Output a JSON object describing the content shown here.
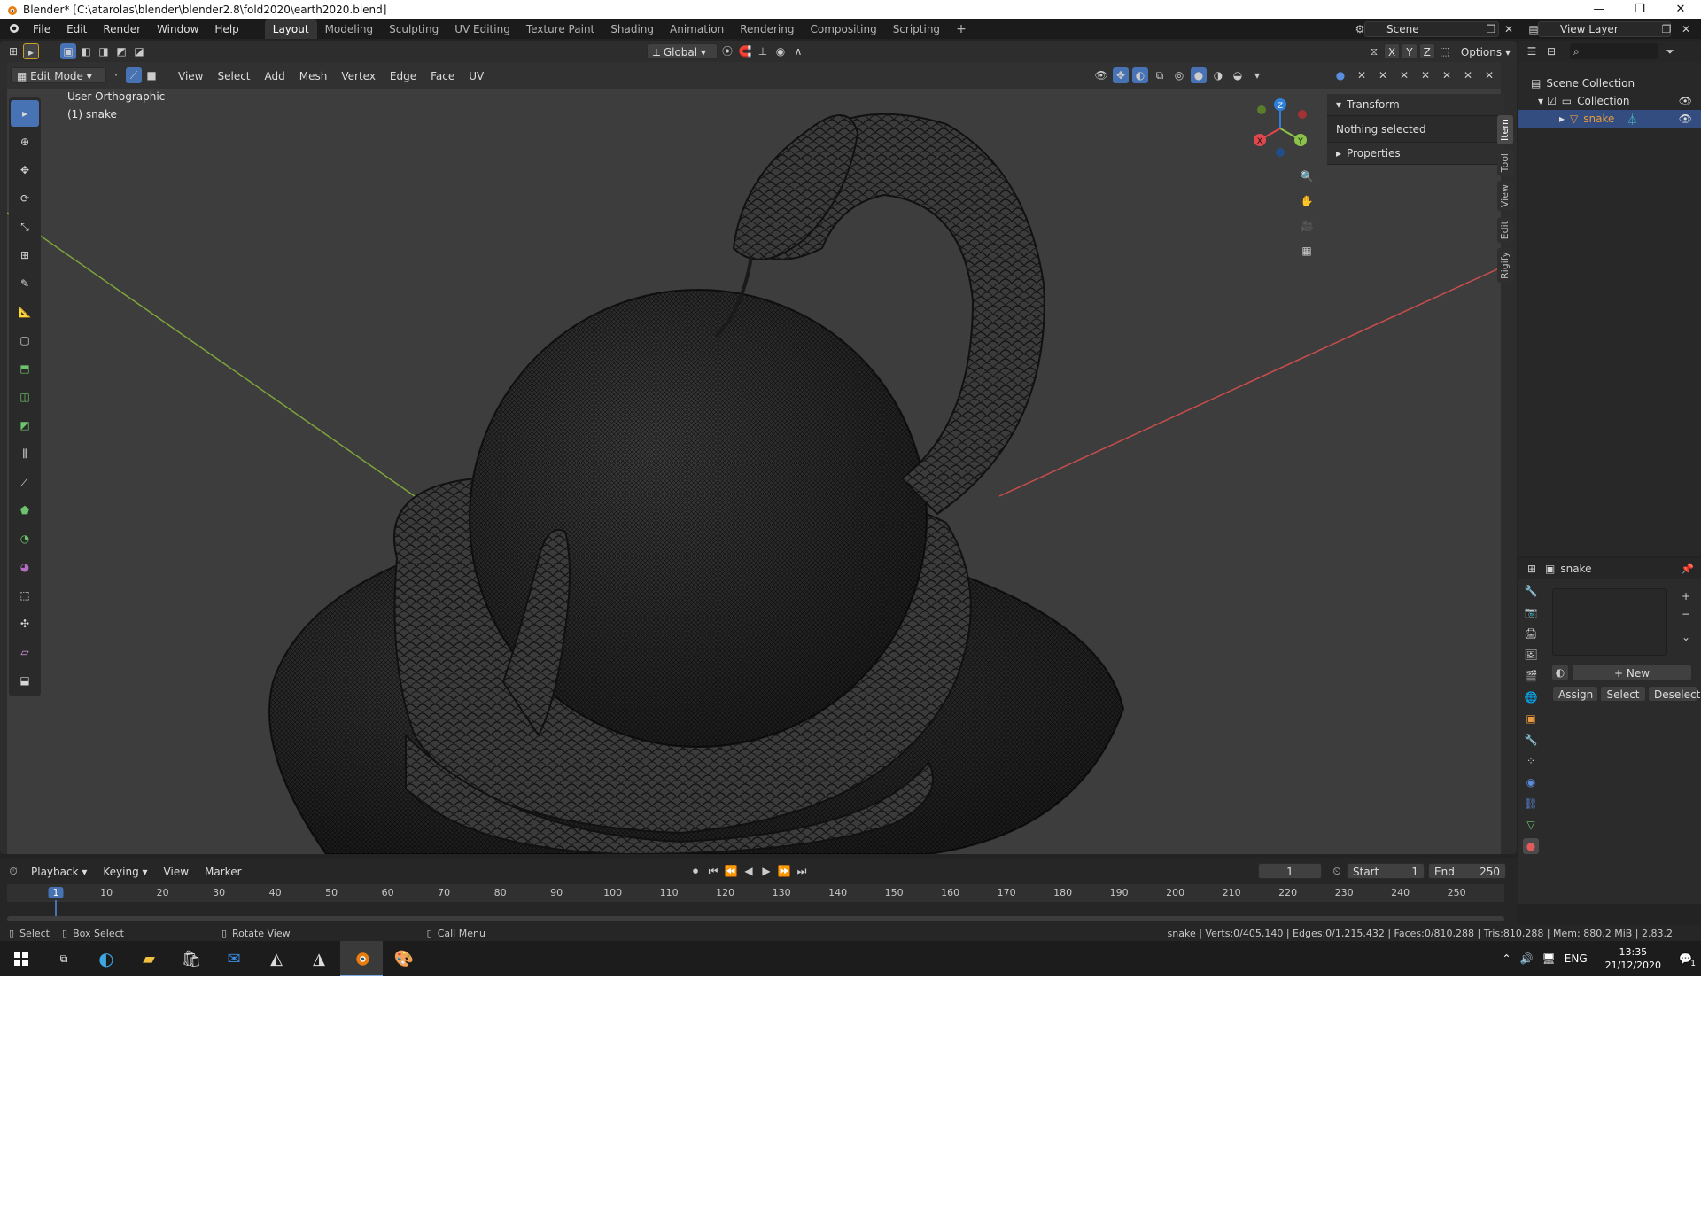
{
  "window": {
    "title": "Blender* [C:\\atarolas\\blender\\blender2.8\\fold2020\\earth2020.blend]",
    "controls": [
      "—",
      "❐",
      "✕"
    ]
  },
  "menu": {
    "items": [
      "File",
      "Edit",
      "Render",
      "Window",
      "Help"
    ]
  },
  "workspaces": {
    "tabs": [
      "Layout",
      "Modeling",
      "Sculpting",
      "UV Editing",
      "Texture Paint",
      "Shading",
      "Animation",
      "Rendering",
      "Compositing",
      "Scripting"
    ],
    "active": "Layout",
    "add": "+"
  },
  "scene": {
    "name": "Scene"
  },
  "view_layer": {
    "name": "View Layer"
  },
  "tool_header": {
    "orientation": "Global",
    "xyz": [
      "X",
      "Y",
      "Z"
    ],
    "options": "Options"
  },
  "viewport_header": {
    "mode": "Edit Mode",
    "menus": [
      "View",
      "Select",
      "Add",
      "Mesh",
      "Vertex",
      "Edge",
      "Face",
      "UV"
    ]
  },
  "viewport": {
    "view_name": "User Orthographic",
    "object_label": "(1) snake",
    "gizmo": {
      "x": "X",
      "y": "Y",
      "z": "Z"
    }
  },
  "npanel": {
    "transform_label": "Transform",
    "nothing_selected": "Nothing selected",
    "properties_label": "Properties",
    "tabs": [
      "Item",
      "Tool",
      "View",
      "Edit",
      "Rigify"
    ],
    "active_tab": "Item"
  },
  "outliner": {
    "scene_collection": "Scene Collection",
    "collection": "Collection",
    "object": "snake"
  },
  "properties": {
    "object_name": "snake",
    "new_label": "New",
    "assign": "Assign",
    "select": "Select",
    "deselect": "Deselect"
  },
  "timeline": {
    "menus": [
      "Playback",
      "Keying",
      "View",
      "Marker"
    ],
    "current_frame": "1",
    "start_label": "Start",
    "start": "1",
    "end_label": "End",
    "end": "250",
    "ruler_ticks": [
      "1",
      "10",
      "20",
      "30",
      "40",
      "50",
      "60",
      "70",
      "80",
      "90",
      "100",
      "110",
      "120",
      "130",
      "140",
      "150",
      "160",
      "170",
      "180",
      "190",
      "200",
      "210",
      "220",
      "230",
      "240",
      "250"
    ]
  },
  "statusbar": {
    "select": "Select",
    "box_select": "Box Select",
    "rotate_view": "Rotate View",
    "call_menu": "Call Menu",
    "stats": "snake | Verts:0/405,140 | Edges:0/1,215,432 | Faces:0/810,288 | Tris:810,288 | Mem: 880.2 MiB | 2.83.2"
  },
  "taskbar": {
    "language": "ENG",
    "time": "13:35",
    "date": "21/12/2020",
    "notifications": "1"
  },
  "colors": {
    "accent": "#4772b3",
    "x_axis": "#c94d4d",
    "y_axis": "#7ea33b",
    "selected_object": "#e89a3c",
    "gizmo_z": "#2e7fd9",
    "gizmo_y": "#8bc34a",
    "gizmo_x": "#e0484e"
  }
}
